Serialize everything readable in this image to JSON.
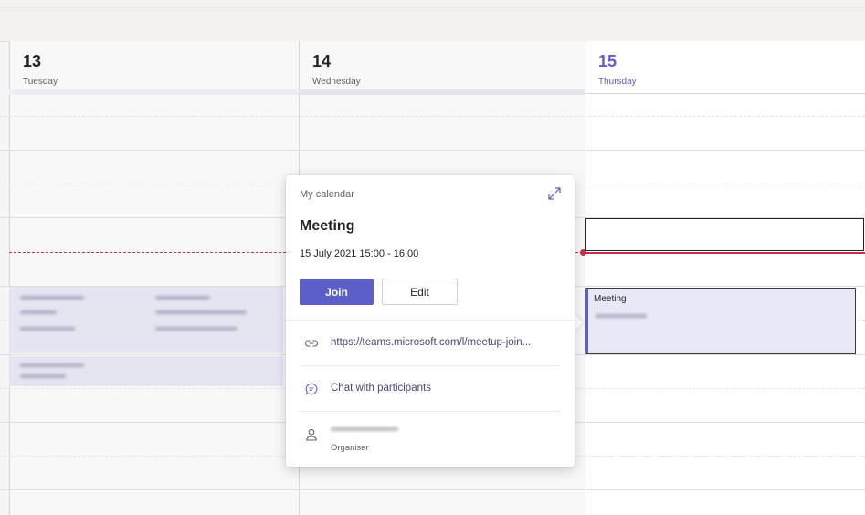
{
  "days": [
    {
      "number": "13",
      "name": "Tuesday"
    },
    {
      "number": "14",
      "name": "Wednesday"
    },
    {
      "number": "15",
      "name": "Thursday"
    }
  ],
  "event": {
    "title": "Meeting"
  },
  "popup": {
    "calendar_name": "My calendar",
    "title": "Meeting",
    "datetime": "15 July 2021 15:00 - 16:00",
    "join_label": "Join",
    "edit_label": "Edit",
    "link": "https://teams.microsoft.com/l/meetup-join...",
    "chat_label": "Chat with participants",
    "organiser_label": "Organiser"
  },
  "icons": {
    "expand": "expand-icon",
    "link": "link-icon",
    "chat": "chat-icon",
    "person": "person-icon"
  },
  "colors": {
    "accent": "#5b5fc7",
    "now_line": "#c4314b",
    "event_bg": "#e8e8f7"
  }
}
